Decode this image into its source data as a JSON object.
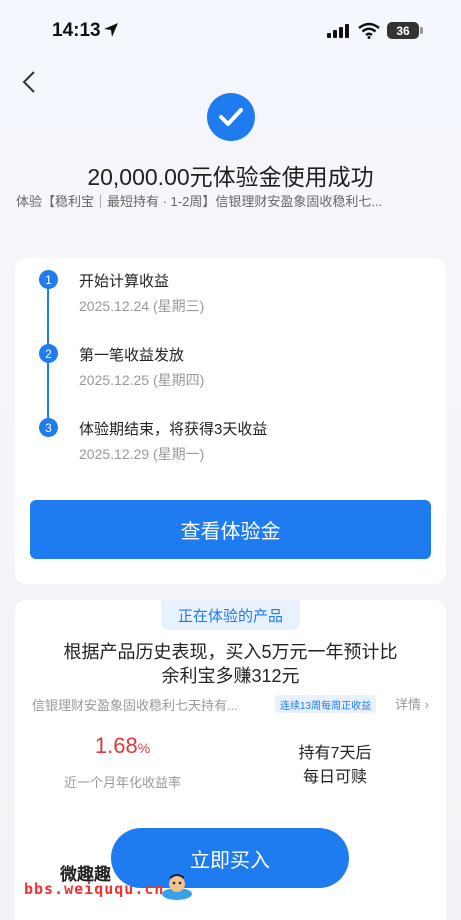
{
  "status_bar": {
    "time": "14:13",
    "battery": "36"
  },
  "header": {
    "title": "20,000.00元体验金使用成功",
    "subtitle": "体验【稳利宝｜最短持有 · 1-2周】信银理财安盈象固收稳利七..."
  },
  "timeline": {
    "steps": [
      {
        "num": "1",
        "label": "开始计算收益",
        "date": "2025.12.24 (星期三)"
      },
      {
        "num": "2",
        "label": "第一笔收益发放",
        "date": "2025.12.25 (星期四)"
      },
      {
        "num": "3",
        "label": "体验期结束，将获得3天收益",
        "date": "2025.12.29 (星期一)"
      }
    ],
    "button_label": "查看体验金"
  },
  "product": {
    "tag": "正在体验的产品",
    "headline_line1": "根据产品历史表现，买入5万元一年预计比",
    "headline_line2": "余利宝多赚312元",
    "name": "信银理财安盈象固收稳利七天持有...",
    "badge": "连续13周每周正收益",
    "details": "详情",
    "yield_value": "1.68",
    "yield_unit": "%",
    "yield_label": "近一个月年化收益率",
    "hold_line1": "持有7天后",
    "hold_line2": "每日可赎",
    "buy_label": "立即买入"
  },
  "watermark": {
    "title": "微趣趣",
    "url": "bbs.weiququ.cn"
  },
  "colors": {
    "accent": "#1f7bf0",
    "yield": "#e0393e"
  }
}
